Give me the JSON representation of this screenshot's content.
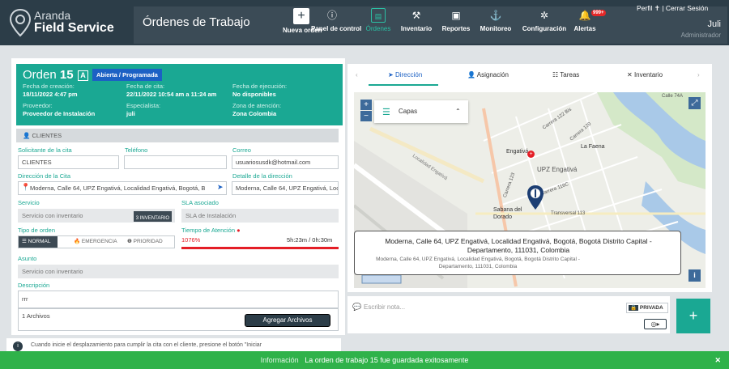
{
  "app": {
    "brand_top": "Aranda",
    "brand_bottom": "Field Service",
    "page_title": "Órdenes de Trabajo"
  },
  "nav": [
    {
      "label": "Nueva orden",
      "icon": "plus-icon"
    },
    {
      "label": "Panel de control",
      "icon": "info-icon"
    },
    {
      "label": "Órdenes",
      "icon": "list-icon"
    },
    {
      "label": "Inventario",
      "icon": "tools-icon"
    },
    {
      "label": "Reportes",
      "icon": "report-icon"
    },
    {
      "label": "Monitoreo",
      "icon": "person-pin-icon"
    },
    {
      "label": "Configuración",
      "icon": "gear-icon"
    },
    {
      "label": "Alertas",
      "icon": "bell-icon"
    }
  ],
  "alerts_badge": "999+",
  "user": {
    "profile": "Perfil",
    "logout": "Cerrar Sesión",
    "name": "Juli",
    "role": "Administrador"
  },
  "order": {
    "prefix": "Orden",
    "number": "15",
    "letter": "A",
    "status": "Abierta / Programada",
    "created_label": "Fecha de creación:",
    "created": "18/11/2022 4:47 pm",
    "appointment_label": "Fecha de cita:",
    "appointment": "22/11/2022 10:54 am a 11:24 am",
    "execution_label": "Fecha de ejecución:",
    "execution": "No disponibles",
    "provider_label": "Proveedor:",
    "provider": "Proveedor de Instalación",
    "specialist_label": "Especialista:",
    "specialist": "juli",
    "zone_label": "Zona de atención:",
    "zone": "Zona Colombia"
  },
  "clients": {
    "section": "CLIENTES",
    "requester_label": "Solicitante de la cita",
    "requester": "CLIENTES",
    "phone_label": "Teléfono",
    "phone": "",
    "email_label": "Correo",
    "email": "usuariosusdk@hotmail.com",
    "address_label": "Dirección de la Cita",
    "address": "Moderna, Calle 64, UPZ Engativá, Localidad Engativá, Bogotá, B",
    "address_detail_label": "Detalle de la dirección",
    "address_detail": "Moderna, Calle 64, UPZ Engativá, Localidad Engativá, L",
    "service_label": "Servicio",
    "service": "Servicio con inventario",
    "service_badge": "3 INVENTARIO",
    "sla_label": "SLA asociado",
    "sla": "SLA de Instalación",
    "order_type_label": "Tipo de orden",
    "order_types": [
      "NORMAL",
      "EMERGENCIA",
      "PRIORIDAD"
    ],
    "attention_label": "Tiempo de Atención",
    "attention_pct": "1076%",
    "attention_time": "5h:23m / 0h:30m",
    "subject_label": "Asunto",
    "subject": "Servicio con inventario",
    "description_label": "Descripción",
    "description": "rrr",
    "files": "1 Archivos",
    "add_files": "Agregar Archivos"
  },
  "tabs": [
    {
      "label": "Dirección",
      "icon": "navigation-icon",
      "active": true
    },
    {
      "label": "Asignación",
      "icon": "person-icon",
      "active": false
    },
    {
      "label": "Tareas",
      "icon": "tasks-icon",
      "active": false
    },
    {
      "label": "Inventario",
      "icon": "tools-icon",
      "active": false
    }
  ],
  "map": {
    "layers": "Capas",
    "popup_main": "Moderna, Calle 64, UPZ Engativá, Localidad Engativá, Bogotá, Bogotá Distrito Capital - Departamento, 111031, Colombia",
    "popup_sub": "Moderna, Calle 64, UPZ Engativá, Localidad Engativá, Bogotá, Bogotá Distrito Capital - Departamento, 111031, Colombia",
    "labels": [
      "UPZ Engativá",
      "Engativá",
      "La Faena",
      "Sabana del Dorado",
      "Transversal 113",
      "Carrera 120",
      "Carrera 116C",
      "Localidad Engativá",
      "Carrera 123",
      "Carrera 122 Bis",
      "Calle 74A"
    ]
  },
  "note": {
    "placeholder": "Escribir nota...",
    "private": "PRIVADA"
  },
  "bottom": {
    "hint": "Cuando inicie el desplazamiento para cumplir la cita con el cliente, presione el botón \"Iniciar"
  },
  "toast": {
    "label": "Información",
    "message": "La orden de trabajo 15 fue guardada exitosamente"
  },
  "colors": {
    "teal": "#1aa893",
    "topbar": "#2c3d48",
    "blue": "#1c61c4",
    "red": "#e41e26",
    "toast": "#2fb24a"
  }
}
